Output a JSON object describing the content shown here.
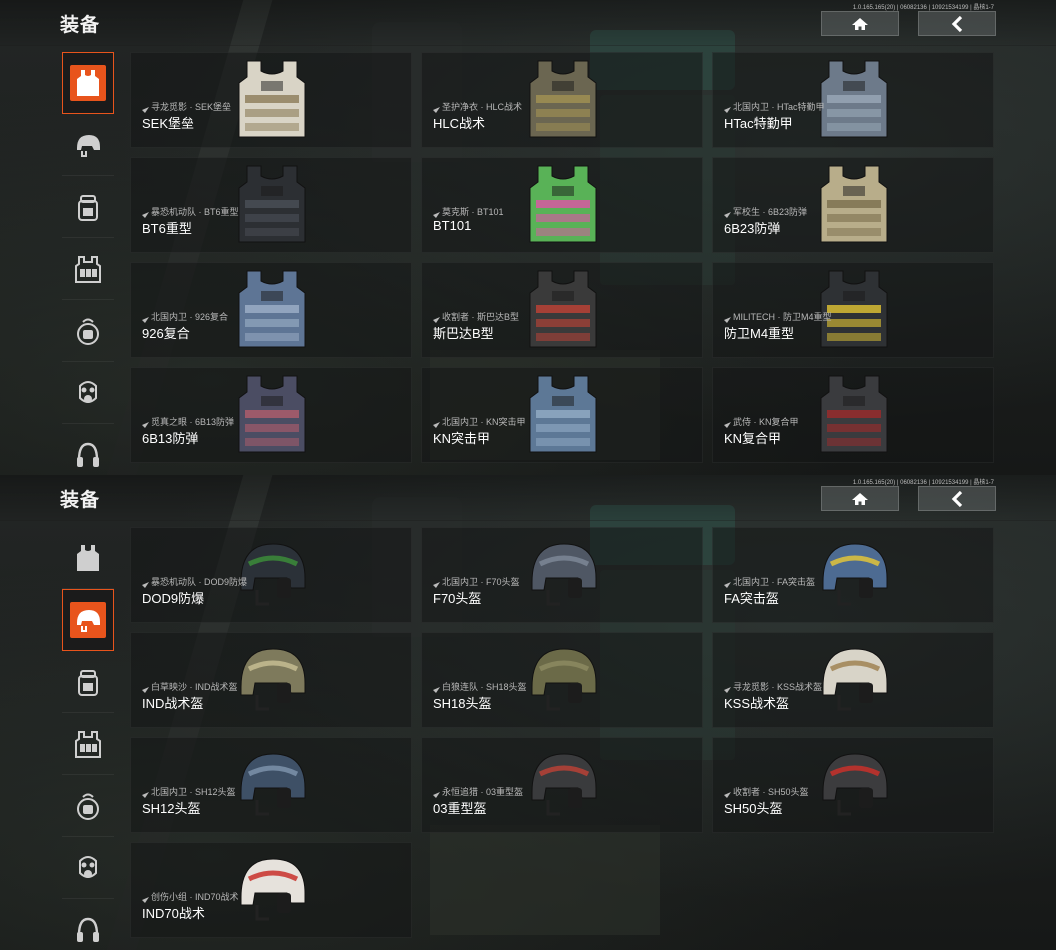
{
  "panels": [
    {
      "title": "装备",
      "version": "1.0.165.165(20) | 06082136 | 10921534199 | 晶核1-7",
      "active_tab": "vest",
      "tabs": [
        {
          "name": "vest-tab",
          "icon": "vest-icon"
        },
        {
          "name": "helmet-tab",
          "icon": "helmet-icon"
        },
        {
          "name": "backpack-tab",
          "icon": "backpack-icon"
        },
        {
          "name": "chest-rig-tab",
          "icon": "chest-rig-icon"
        },
        {
          "name": "bag-tab",
          "icon": "bag-icon"
        },
        {
          "name": "gas-mask-tab",
          "icon": "gas-mask-icon"
        },
        {
          "name": "headset-tab",
          "icon": "headset-icon"
        }
      ],
      "items": [
        {
          "sub": "寻龙觅影 · SEK堡垒",
          "name": "SEK堡垒",
          "color": "#d9d4c6",
          "accent": "#8b7b58"
        },
        {
          "sub": "圣护净衣 · HLC战术",
          "name": "HLC战术",
          "color": "#6b6651",
          "accent": "#a39253"
        },
        {
          "sub": "北国内卫 · HTac特勤甲",
          "name": "HTac特勤甲",
          "color": "#6d7a8a",
          "accent": "#9aa9b8"
        },
        {
          "sub": "暴恐机动队 · BT6重型",
          "name": "BT6重型",
          "color": "#2c2f33",
          "accent": "#4b5058"
        },
        {
          "sub": "莫克斯 · BT101",
          "name": "BT101",
          "color": "#59b257",
          "accent": "#e053a8"
        },
        {
          "sub": "军校生 · 6B23防弹",
          "name": "6B23防弹",
          "color": "#b8ad8a",
          "accent": "#7a6e4c"
        },
        {
          "sub": "北国内卫 · 926复合",
          "name": "926复合",
          "color": "#5e7595",
          "accent": "#9db0c8"
        },
        {
          "sub": "收割者 · 斯巴达B型",
          "name": "斯巴达B型",
          "color": "#3a3a3a",
          "accent": "#c24236"
        },
        {
          "sub": "MILITECH · 防卫M4重型",
          "name": "防卫M4重型",
          "color": "#2e3134",
          "accent": "#e2c533"
        },
        {
          "sub": "觅真之眼 · 6B13防弹",
          "name": "6B13防弹",
          "color": "#4b4d63",
          "accent": "#b25e6c"
        },
        {
          "sub": "北国内卫 · KN突击甲",
          "name": "KN突击甲",
          "color": "#5d7896",
          "accent": "#93acc6"
        },
        {
          "sub": "武侍 · KN复合甲",
          "name": "KN复合甲",
          "color": "#3a3b3e",
          "accent": "#9e2b2b"
        }
      ]
    },
    {
      "title": "装备",
      "version": "1.0.165.165(20) | 06082136 | 10921534199 | 晶核1-7",
      "active_tab": "helmet",
      "tabs": [
        {
          "name": "vest-tab",
          "icon": "vest-icon"
        },
        {
          "name": "helmet-tab",
          "icon": "helmet-icon"
        },
        {
          "name": "backpack-tab",
          "icon": "backpack-icon"
        },
        {
          "name": "chest-rig-tab",
          "icon": "chest-rig-icon"
        },
        {
          "name": "bag-tab",
          "icon": "bag-icon"
        },
        {
          "name": "gas-mask-tab",
          "icon": "gas-mask-icon"
        },
        {
          "name": "headset-tab",
          "icon": "headset-icon"
        }
      ],
      "items": [
        {
          "sub": "暴恐机动队 · DOD9防爆",
          "name": "DOD9防爆",
          "color": "#2b3138",
          "accent": "#3c8c3a"
        },
        {
          "sub": "北国内卫 · F70头盔",
          "name": "F70头盔",
          "color": "#4f5764",
          "accent": "#7c8797"
        },
        {
          "sub": "北国内卫 · FA突击盔",
          "name": "FA突击盔",
          "color": "#4d6b92",
          "accent": "#e2c43a"
        },
        {
          "sub": "白草映沙 · IND战术盔",
          "name": "IND战术盔",
          "color": "#7e7a5c",
          "accent": "#c5bd92"
        },
        {
          "sub": "白狼连队 · SH18头盔",
          "name": "SH18头盔",
          "color": "#6b6a48",
          "accent": "#8c8a62"
        },
        {
          "sub": "寻龙觅影 · KSS战术盔",
          "name": "KSS战术盔",
          "color": "#d8d4c8",
          "accent": "#a08352"
        },
        {
          "sub": "北国内卫 · SH12头盔",
          "name": "SH12头盔",
          "color": "#3e5066",
          "accent": "#7d92aa"
        },
        {
          "sub": "永恒追猎 · 03重型盔",
          "name": "03重型盔",
          "color": "#3a3b3d",
          "accent": "#b84236"
        },
        {
          "sub": "收割者 · SH50头盔",
          "name": "SH50头盔",
          "color": "#3c3c3e",
          "accent": "#c8302a"
        },
        {
          "sub": "创伤小组 · IND70战术",
          "name": "IND70战术",
          "color": "#e6e2dc",
          "accent": "#c8302a"
        }
      ]
    }
  ],
  "colors": {
    "accent": "#e8541c",
    "card_bg": "#141616"
  }
}
